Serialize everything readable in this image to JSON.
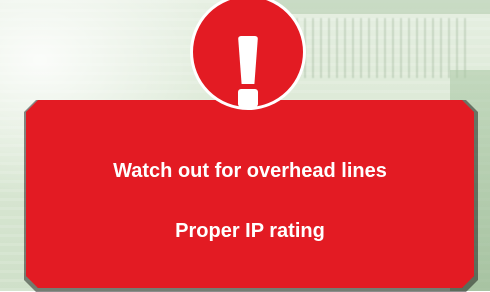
{
  "warning": {
    "icon": "exclamation-icon",
    "lines": [
      "Watch out for overhead lines",
      "Proper IP rating"
    ]
  },
  "colors": {
    "banner_red": "#e31b23",
    "text": "#ffffff",
    "background": "#dce9d6"
  }
}
